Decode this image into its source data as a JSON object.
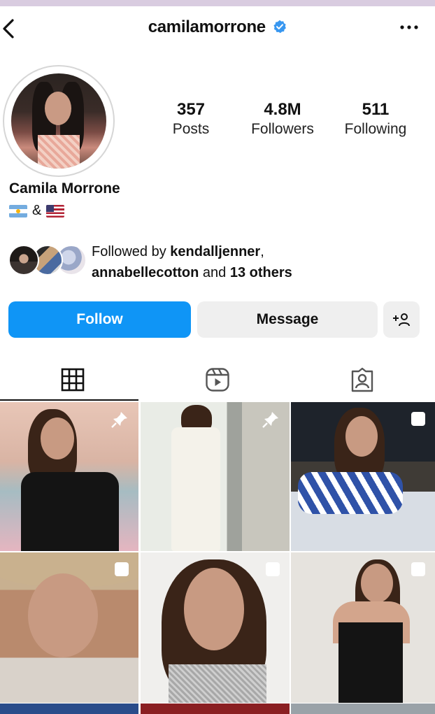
{
  "header": {
    "username": "camilamorrone",
    "verified": true
  },
  "profile": {
    "stats": {
      "posts_count": "357",
      "posts_label": "Posts",
      "followers_count": "4.8M",
      "followers_label": "Followers",
      "following_count": "511",
      "following_label": "Following"
    },
    "full_name": "Camila Morrone",
    "bio_separator": "&",
    "followed_by": {
      "prefix": "Followed by ",
      "user1": "kendalljenner",
      "sep": ",",
      "user2": "annabellecotton",
      "and": " and ",
      "others": "13 others"
    }
  },
  "buttons": {
    "follow": "Follow",
    "message": "Message"
  },
  "colors": {
    "accent": "#0f95f6",
    "verified": "#3897f0",
    "secondary_button": "#efefef"
  },
  "tabs": [
    {
      "icon": "grid-icon",
      "active": true
    },
    {
      "icon": "reels-icon",
      "active": false
    },
    {
      "icon": "tagged-icon",
      "active": false
    }
  ]
}
